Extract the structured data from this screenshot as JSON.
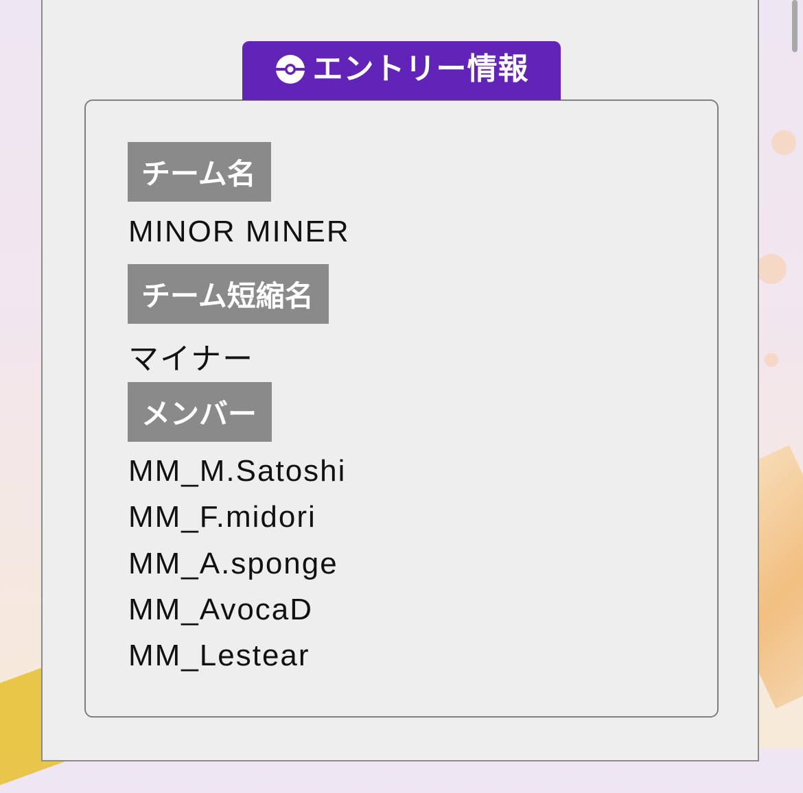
{
  "entry_tab": {
    "icon": "monster-ball-icon",
    "label": "エントリー情報",
    "color": "#6223b9"
  },
  "fields": {
    "team_name": {
      "label": "チーム名",
      "value": "MINOR MINER"
    },
    "team_short_name": {
      "label": "チーム短縮名",
      "value": "マイナー"
    },
    "members": {
      "label": "メンバー",
      "list": [
        "MM_M.Satoshi",
        "MM_F.midori",
        "MM_A.sponge",
        "MM_AvocaD",
        "MM_Lestear"
      ]
    }
  },
  "colors": {
    "panel_background": "#eeeeee",
    "label_badge": "#8a8a8a",
    "label_text": "#ffffff",
    "value_text": "#111111"
  }
}
